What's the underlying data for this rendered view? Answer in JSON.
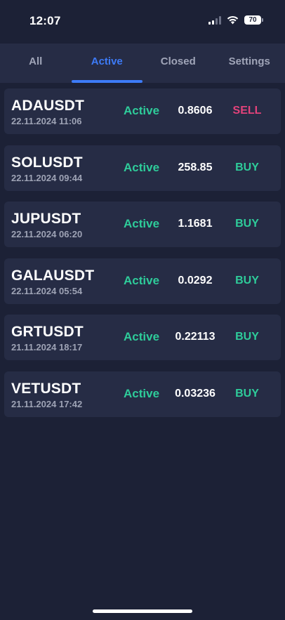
{
  "status_bar": {
    "time": "12:07",
    "battery": "70",
    "icons": [
      "cellular-signal-icon",
      "wifi-icon",
      "battery-icon"
    ]
  },
  "tabs": [
    {
      "label": "All",
      "active": false
    },
    {
      "label": "Active",
      "active": true
    },
    {
      "label": "Closed",
      "active": false
    },
    {
      "label": "Settings",
      "active": false
    }
  ],
  "colors": {
    "background": "#1c2136",
    "card": "#262c45",
    "accent": "#3d7bf7",
    "active_green": "#2ecc9a",
    "sell_pink": "#e2427a"
  },
  "trades": [
    {
      "symbol": "ADAUSDT",
      "datetime": "22.11.2024 11:06",
      "status": "Active",
      "price": "0.8606",
      "side": "SELL"
    },
    {
      "symbol": "SOLUSDT",
      "datetime": "22.11.2024 09:44",
      "status": "Active",
      "price": "258.85",
      "side": "BUY"
    },
    {
      "symbol": "JUPUSDT",
      "datetime": "22.11.2024 06:20",
      "status": "Active",
      "price": "1.1681",
      "side": "BUY"
    },
    {
      "symbol": "GALAUSDT",
      "datetime": "22.11.2024 05:54",
      "status": "Active",
      "price": "0.0292",
      "side": "BUY"
    },
    {
      "symbol": "GRTUSDT",
      "datetime": "21.11.2024 18:17",
      "status": "Active",
      "price": "0.22113",
      "side": "BUY"
    },
    {
      "symbol": "VETUSDT",
      "datetime": "21.11.2024 17:42",
      "status": "Active",
      "price": "0.03236",
      "side": "BUY"
    }
  ]
}
